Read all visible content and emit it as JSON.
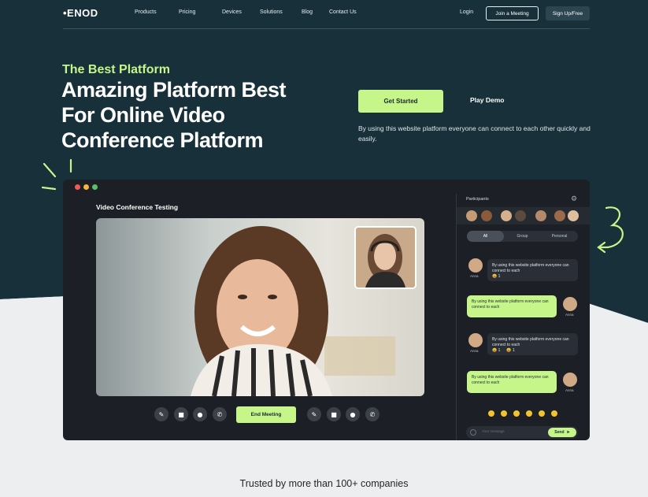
{
  "nav": {
    "logo": "•ENOD",
    "links": [
      "Products",
      "Pricing",
      "Devices",
      "Solutions",
      "Blog",
      "Contact Us"
    ],
    "login": "Login",
    "join": "Join a Meeting",
    "signup": "Sign Up/Free"
  },
  "hero": {
    "kicker": "The Best Platform",
    "headline": [
      "Amazing Platform Best",
      "For Online Video",
      "Conference Platform"
    ],
    "cta_primary": "Get Started",
    "cta_secondary": "Play Demo",
    "description": "By using this website platform everyone can connect to each other quickly and easily."
  },
  "app": {
    "title": "Video Conference Testing",
    "end_meeting": "End Meeting",
    "participants_title": "Participants",
    "tabs": [
      "All",
      "Group",
      "Personal"
    ],
    "active_tab": "All",
    "messages": [
      {
        "side": "in",
        "text": "By using this website platform everyone can connect to each",
        "name": "Anna",
        "reactions": [
          "😀 1"
        ]
      },
      {
        "side": "out",
        "text": "By using this website platform everyone can connect to each",
        "name": "Anna"
      },
      {
        "side": "in",
        "text": "By using this website platform everyone can connect to each",
        "name": "Anna",
        "reactions": [
          "😀 1",
          "😀 1"
        ]
      },
      {
        "side": "out",
        "text": "By using this website platform everyone can connect to each",
        "name": "Anna"
      }
    ],
    "chat_placeholder": "Your message",
    "send": "Send"
  },
  "trusted": "Trusted by more than 100+ companies",
  "colors": {
    "dark_teal": "#17303a",
    "accent_green": "#c6f58a",
    "app_bg": "#1c2026"
  }
}
